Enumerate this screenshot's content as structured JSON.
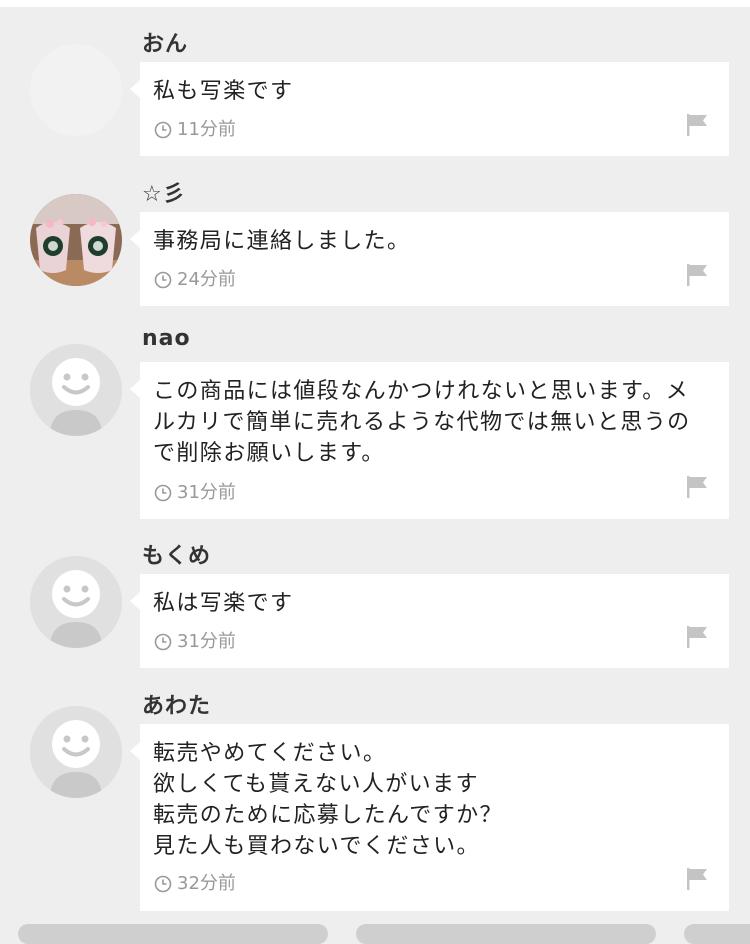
{
  "comments": [
    {
      "name": "おん",
      "lines": [
        "私も写楽です"
      ],
      "time": "11分前",
      "avatar": "blank"
    },
    {
      "name": "☆彡",
      "lines": [
        "事務局に連絡しました。"
      ],
      "time": "24分前",
      "avatar": "photo"
    },
    {
      "name": "nao",
      "lines": [
        "この商品には値段なんかつけれないと思います。メ",
        "ルカリで簡単に売れるような代物では無いと思うの",
        "で削除お願いします。"
      ],
      "time": "31分前",
      "avatar": "default-face"
    },
    {
      "name": "もくめ",
      "lines": [
        "私は写楽です"
      ],
      "time": "31分前",
      "avatar": "default-face"
    },
    {
      "name": "あわた",
      "lines": [
        "転売やめてください。",
        "欲しくても貰えない人がいます",
        "転売のために応募したんですか？",
        "見た人も買わないでください。"
      ],
      "time": "32分前",
      "avatar": "default-face"
    }
  ],
  "icons": {
    "time": "clock-icon",
    "report": "flag-icon"
  },
  "colors": {
    "background": "#eeeeee",
    "bubble": "#ffffff",
    "meta_text": "#999999",
    "name_text": "#333333"
  }
}
